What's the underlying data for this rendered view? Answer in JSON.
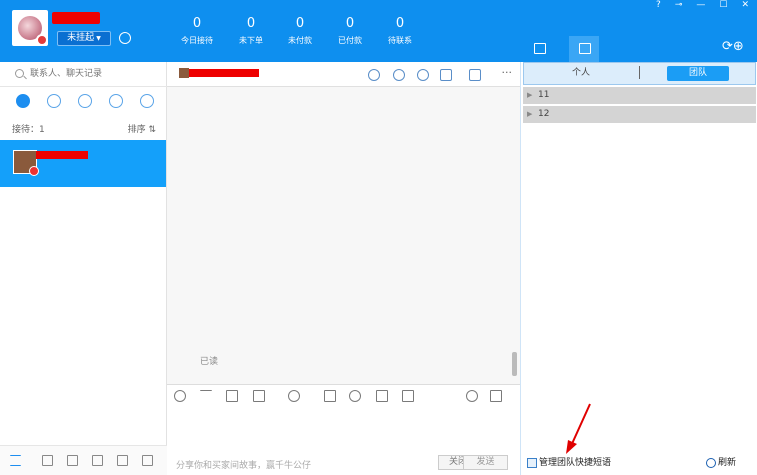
{
  "header": {
    "status_label": "未挂起",
    "stats": [
      {
        "value": "0",
        "label": "今日接待"
      },
      {
        "value": "0",
        "label": "未下单"
      },
      {
        "value": "0",
        "label": "未付款"
      },
      {
        "value": "0",
        "label": "已付款"
      },
      {
        "value": "0",
        "label": "待联系"
      }
    ],
    "window_controls": [
      "?",
      "⊸",
      "—",
      "☐",
      "✕"
    ]
  },
  "sidebar": {
    "search_placeholder": "联系人、聊天记录",
    "reception_label": "接待：1",
    "sort_label": "排序 ⇅"
  },
  "chat": {
    "read_label": "已读",
    "input_placeholder": "分享你和买家间故事，赢千牛公仔",
    "close_label": "关闭",
    "send_label": "发送"
  },
  "right_panel": {
    "tabs": [
      "个人",
      "团队"
    ],
    "groups": [
      "11",
      "12"
    ],
    "manage_label": "管理团队快捷短语",
    "refresh_label": "刷新"
  },
  "colors": {
    "header_bg": "#0e8fef",
    "selected_contact_bg": "#14a0fa",
    "redacted": "#e00000",
    "annotation_arrow": "#e00000"
  }
}
